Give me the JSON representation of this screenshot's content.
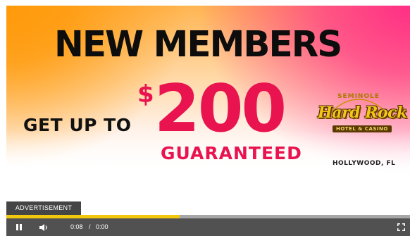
{
  "ad": {
    "headline": "NEW MEMBERS",
    "offer_prefix": "GET UP TO",
    "currency_symbol": "$",
    "amount": "200",
    "offer_suffix": "GUARANTEED",
    "logo": {
      "top_text": "SEMINOLE",
      "brand": "Hard Rock",
      "subtitle": "HOTEL & CASINO",
      "location": "HOLLYWOOD, FL"
    }
  },
  "player": {
    "ad_label": "ADVERTISEMENT",
    "current_time": "0:08",
    "separator": "/",
    "duration": "0:00",
    "progress_fraction": 0.43,
    "icons": {
      "play_pause": "pause-icon",
      "volume": "volume-icon",
      "fullscreen": "fullscreen-icon"
    }
  },
  "colors": {
    "accent_red": "#e8134f",
    "progress": "#f2c80f",
    "control_bar": "#515151",
    "gradient_orange": "#ff9a0a",
    "gradient_pink": "#ff2f86"
  }
}
